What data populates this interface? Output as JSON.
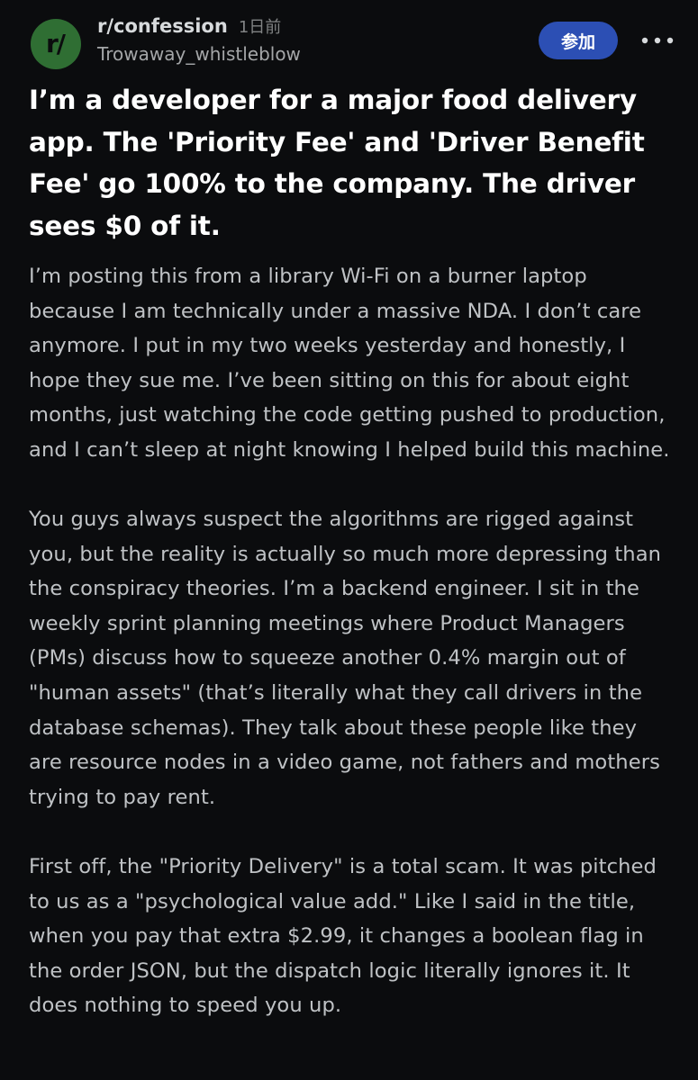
{
  "post": {
    "subreddit": "r/confession",
    "time_ago": "1日前",
    "username": "Trowaway_whistleblow",
    "avatar_text": "r/",
    "join_label": "参加",
    "title": "I’m a developer for a major food delivery app. The 'Priority Fee' and 'Driver Benefit Fee' go 100% to the company. The driver sees $0 of it.",
    "paragraphs": [
      "I’m posting this from a library Wi-Fi on a burner laptop because I am technically under a massive NDA. I don’t care anymore. I put in my two weeks yesterday and honestly, I hope they sue me. I’ve been sitting on this for about eight months, just watching the code getting pushed to production, and I can’t sleep at night knowing I helped build this machine.",
      "You guys always suspect the algorithms are rigged against you, but the reality is actually so much more depressing than the conspiracy theories. I’m a backend engineer. I sit in the weekly sprint planning meetings where Product Managers (PMs) discuss how to squeeze another 0.4% margin out of \"human assets\" (that’s literally what they call drivers in the database schemas). They talk about these people like they are resource nodes in a video game, not fathers and mothers trying to pay rent.",
      "First off, the \"Priority Delivery\" is a total scam. It was pitched to us as a \"psychological value add.\" Like I said in the title, when you pay that extra $2.99, it changes a boolean flag in the order JSON, but the dispatch logic literally ignores it. It does nothing to speed you up."
    ]
  },
  "colors": {
    "background": "#0b0c0e",
    "avatar": "#2f6e33",
    "join_button": "#2c4fb4",
    "title_text": "#ffffff",
    "body_text": "#bfc2c5"
  }
}
